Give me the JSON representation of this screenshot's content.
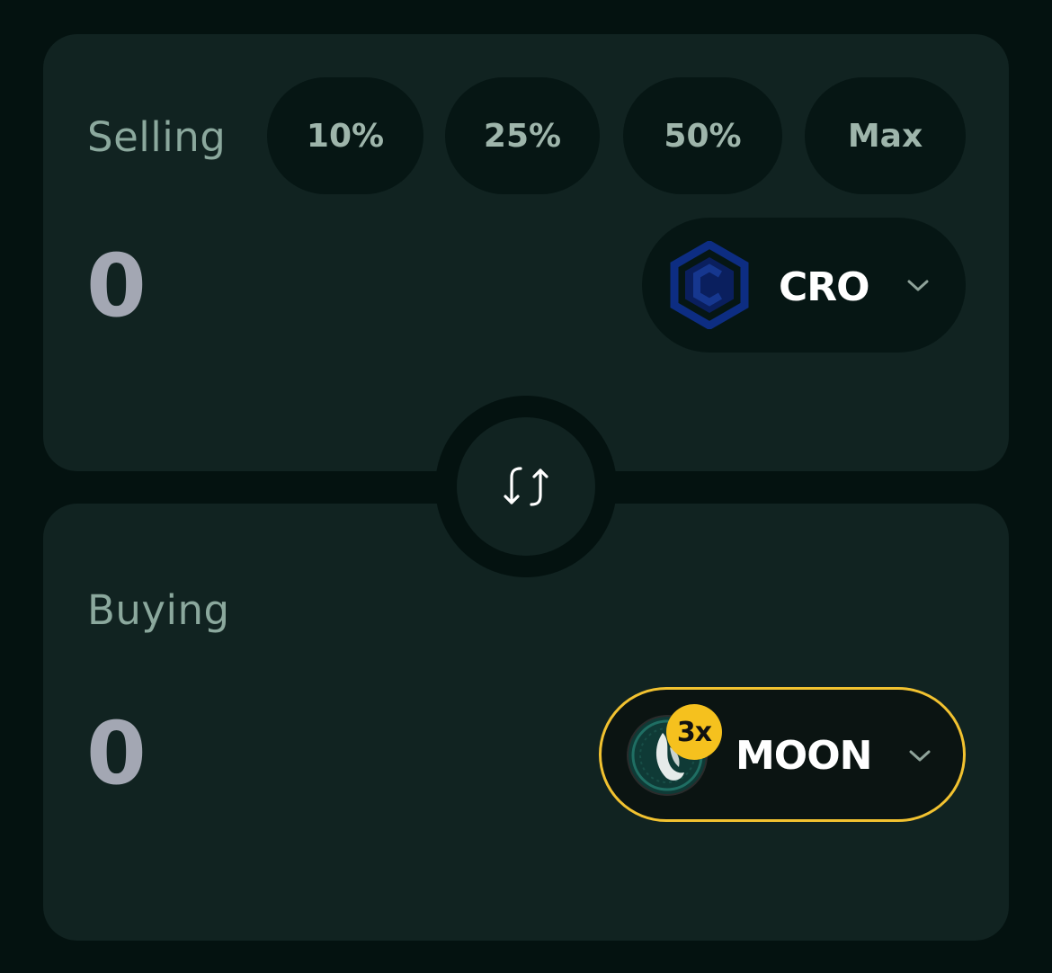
{
  "selling": {
    "label": "Selling",
    "amount": "0",
    "percent_buttons": [
      "10%",
      "25%",
      "50%",
      "Max"
    ],
    "token": {
      "symbol": "CRO",
      "icon": "cro-hexagon-logo"
    }
  },
  "swap": {
    "icon": "swap-arrows-icon"
  },
  "buying": {
    "label": "Buying",
    "amount": "0",
    "token": {
      "symbol": "MOON",
      "icon": "moon-wolf-logo",
      "badge": "3x"
    }
  },
  "colors": {
    "background": "#041210",
    "panel": "#112321",
    "pill": "#061614",
    "accent_gold": "#f2c230",
    "cro_blue": "#0b2a7a"
  }
}
